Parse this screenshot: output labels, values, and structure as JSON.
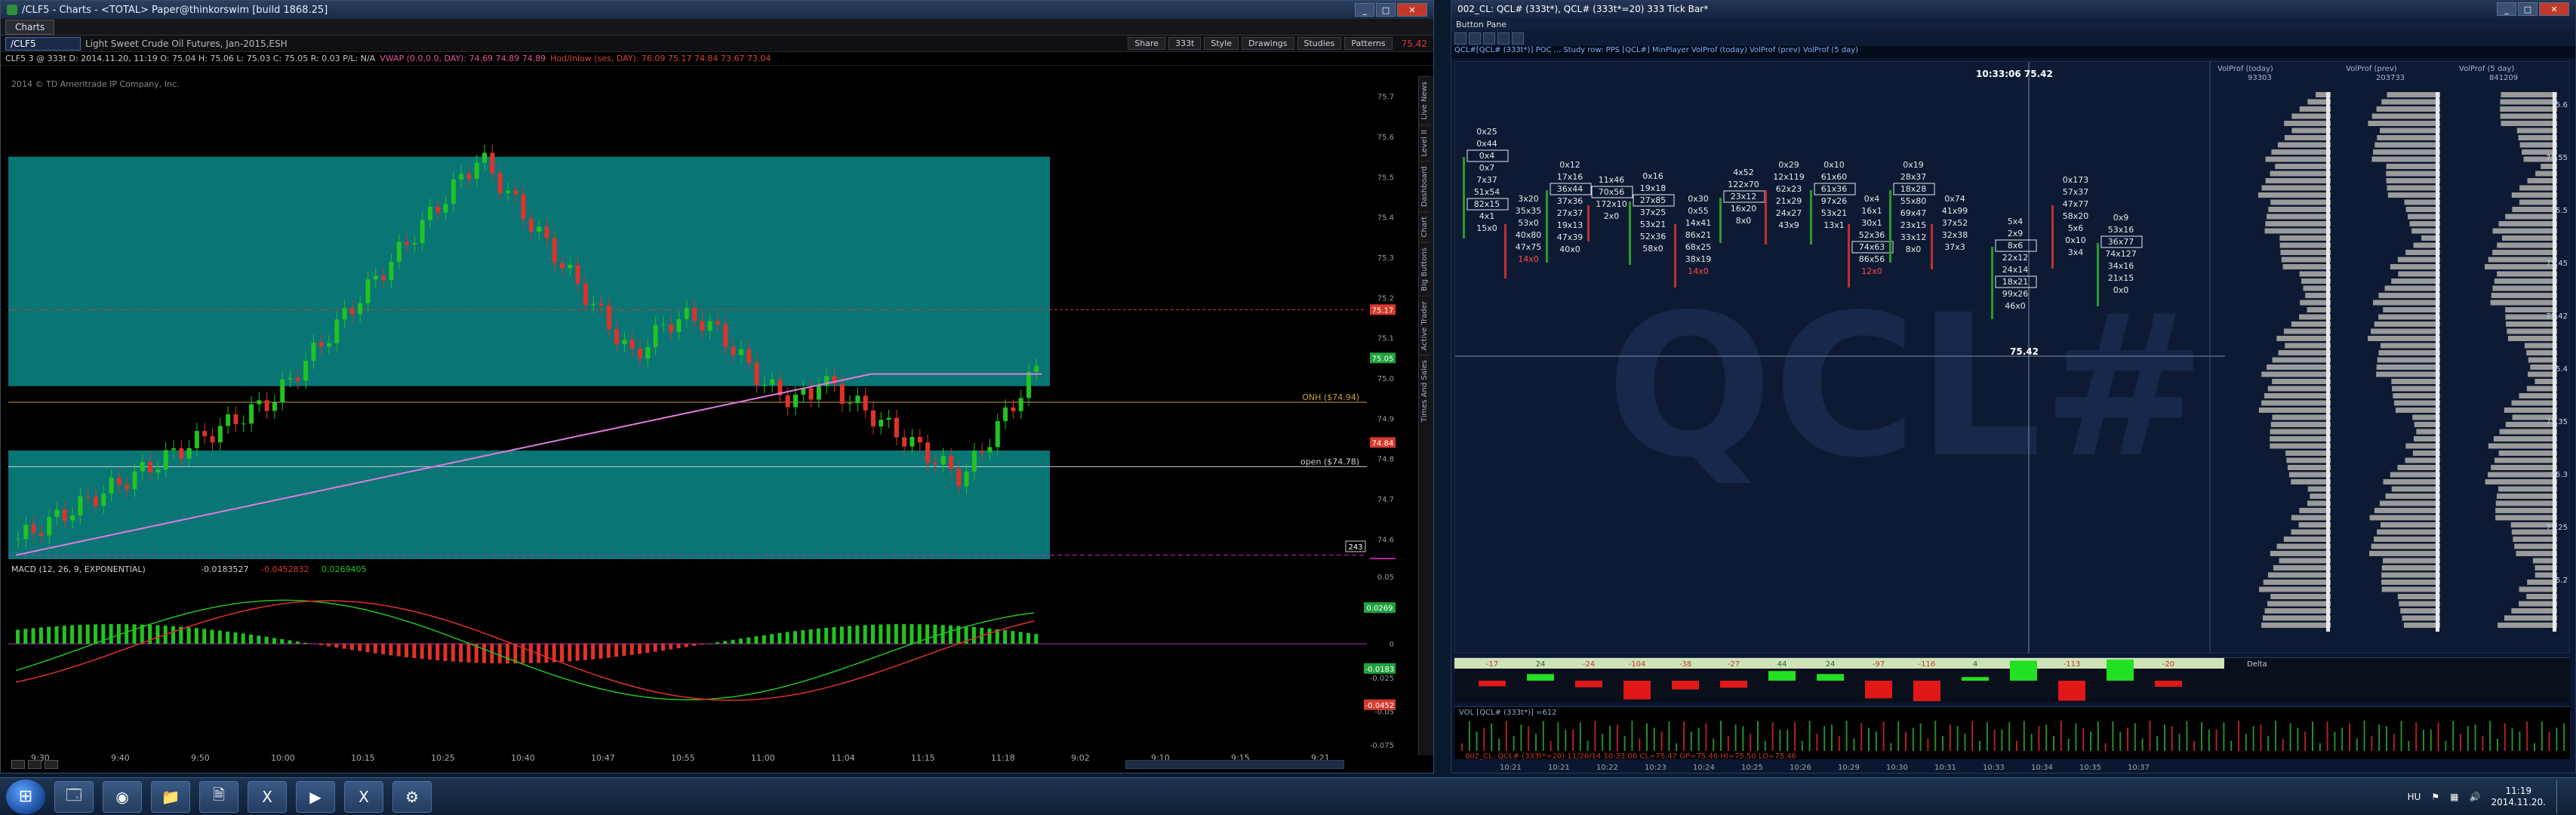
{
  "tos": {
    "title": "/CLF5 - Charts - <TOTAL> Paper@thinkorswim [build 1868.25]",
    "tab_label": "Charts",
    "symbol": "/CLF5",
    "symbol_desc": "Light Sweet Crude Oil Futures, Jan-2015,ESH",
    "toolbar": [
      "Share",
      "333t",
      "Style",
      "Drawings",
      "Studies",
      "Patterns"
    ],
    "last_price": "75.42",
    "info": "CLF5 3 @ 333t  D: 2014.11.20, 11:19  O: 75.04  H: 75.06  L: 75.03  C: 75.05  R: 0.03  P/L: N/A",
    "vwap": "VWAP (0.0,0.0, DAY): 74.69  74.89  74.89",
    "hod": "Hod/Inlow (ses, DAY): 76.09  75.17  74.84  73.67  73.04",
    "copyright": "2014 © TD Ameritrade IP Company, Inc.",
    "onh_label": "ONH ($74.94)",
    "open_label": "open ($74.78)",
    "badge_243": "243",
    "sidebar": [
      "Live News",
      "Level II",
      "Dashboard",
      "Chart",
      "Big Buttons",
      "Active Trader",
      "Times And Sales"
    ],
    "price_axis": [
      "75.7",
      "75.6",
      "75.5",
      "75.4",
      "75.3",
      "75.2",
      "75.1",
      "75.0",
      "74.9",
      "74.8",
      "74.7",
      "74.6"
    ],
    "time_axis": [
      "9:30",
      "9:40",
      "9:50",
      "10:00",
      "10:15",
      "10:25",
      "10:40",
      "10:47",
      "10:55",
      "11:00",
      "11:04",
      "11:15",
      "11:18",
      "9:02",
      "9:10",
      "9:15",
      "9:21"
    ],
    "price_tags": [
      {
        "label": "75.17",
        "color": "#d43a2f"
      },
      {
        "label": "75.05",
        "color": "#1fa33c"
      },
      {
        "label": "74.84",
        "color": "#d43a2f"
      },
      {
        "label": "74.54",
        "color": "#e01ec8"
      }
    ],
    "macd": {
      "label": "MACD (12, 26, 9, EXPONENTIAL)",
      "v1": "-0.0183527",
      "v2": "-0.0452832",
      "v3": "0.0269405",
      "tags": [
        {
          "label": "0.0269",
          "color": "#1fa33c"
        },
        {
          "label": "-0.0183",
          "color": "#1fa33c"
        },
        {
          "label": "-0.0452",
          "color": "#d43a2f"
        }
      ],
      "axis": [
        "0.05",
        "0.025",
        "0",
        "-0.025",
        "-0.05",
        "-0.075"
      ]
    }
  },
  "qcl": {
    "title": "002_CL: QCL# (333t*), QCL# (333t*=20) 333 Tick Bar*",
    "menu": "Button Pane",
    "studybar": "QCL#[QCL# (333t*)] POC ... Study row: PPS [QCL#]  MinPlayer  VolProf (today)  VolProf (prev)  VolProf (5 day)",
    "time_cursor": "10:33:06 75.42",
    "price_cursor": "75.42",
    "delta_label": "Delta",
    "delta_values": [
      "-17",
      "24",
      "-24",
      "-104",
      "-38",
      "-27",
      "44",
      "24",
      "-97",
      "-116",
      "4",
      "113",
      "-113",
      "157",
      "-20"
    ],
    "vol_label": "VOL [QCL# (333t*)] =612",
    "ohlc_line": "002_CL: QCL# (333t*=20) 11/20/14 10:33:06 CL=75.47 OP=75.46 HI=75.50 LO=75.46",
    "times": [
      "10:21",
      "10:21",
      "10:22",
      "10:23",
      "10:24",
      "10:25",
      "10:26",
      "10:29",
      "10:30",
      "10:31",
      "10:33",
      "10:34",
      "10:35",
      "10:37"
    ],
    "vp_headers": [
      "VolProf (today)",
      "VolProf (prev)",
      "VolProf (5 day)"
    ],
    "vp_totals": [
      "93303",
      "203733",
      "841209",
      "841209"
    ],
    "prices": [
      "75.6",
      "75.55",
      "75.5",
      "75.45",
      "75.42",
      "75.4",
      "75.35",
      "75.3",
      "75.25",
      "75.2"
    ],
    "footprint": [
      {
        "col": 0,
        "cells": [
          "0x25",
          "0x44",
          "0x4",
          "0x7",
          "7x37",
          "51x54",
          "82x15",
          "4x1",
          "15x0"
        ]
      },
      {
        "col": 1,
        "cells": [
          "3x20",
          "35x35",
          "53x0",
          "40x80",
          "47x75",
          "14x0"
        ]
      },
      {
        "col": 2,
        "cells": [
          "0x12",
          "17x16",
          "36x44",
          "37x36",
          "27x37",
          "19x13",
          "47x39",
          "40x0"
        ]
      },
      {
        "col": 3,
        "cells": [
          "11x46",
          "70x56",
          "172x10",
          "2x0"
        ]
      },
      {
        "col": 4,
        "cells": [
          "0x16",
          "19x18",
          "27x85",
          "37x25",
          "53x21",
          "52x36",
          "58x0"
        ]
      },
      {
        "col": 5,
        "cells": [
          "0x30",
          "0x55",
          "14x41",
          "86x21",
          "68x25",
          "38x19",
          "14x0"
        ]
      },
      {
        "col": 6,
        "cells": [
          "4x52",
          "122x70",
          "23x12",
          "16x20",
          "8x0"
        ]
      },
      {
        "col": 7,
        "cells": [
          "0x29",
          "12x119",
          "62x23",
          "21x29",
          "24x27",
          "43x9"
        ]
      },
      {
        "col": 8,
        "cells": [
          "0x10",
          "61x60",
          "61x36",
          "97x26",
          "53x21",
          "13x1"
        ]
      },
      {
        "col": 9,
        "cells": [
          "0x4",
          "16x1",
          "30x1",
          "52x36",
          "74x63",
          "86x56",
          "12x0"
        ]
      },
      {
        "col": 10,
        "cells": [
          "0x19",
          "28x37",
          "18x28",
          "55x80",
          "69x47",
          "23x15",
          "33x12",
          "8x0"
        ]
      },
      {
        "col": 11,
        "cells": [
          "0x74",
          "41x99",
          "37x52",
          "32x38",
          "37x3"
        ]
      },
      {
        "col": 12,
        "cells": [
          "5x4",
          "2x9",
          "8x6",
          "22x12",
          "24x14",
          "18x21",
          "99x26",
          "46x0"
        ]
      },
      {
        "col": 13,
        "cells": [
          "0x173",
          "57x37",
          "47x77",
          "58x20",
          "5x6",
          "0x10",
          "3x4"
        ]
      },
      {
        "col": 14,
        "cells": [
          "0x9",
          "53x16",
          "36x77",
          "74x127",
          "34x16",
          "21x15",
          "0x0"
        ]
      }
    ]
  },
  "taskbar": {
    "apps": [
      "explorer-icon",
      "chrome-icon",
      "folder-icon",
      "document-icon",
      "excel-icon",
      "tos-icon",
      "excel-icon-2",
      "app-icon"
    ],
    "lang": "HU",
    "time": "11:19",
    "date": "2014.11.20."
  }
}
